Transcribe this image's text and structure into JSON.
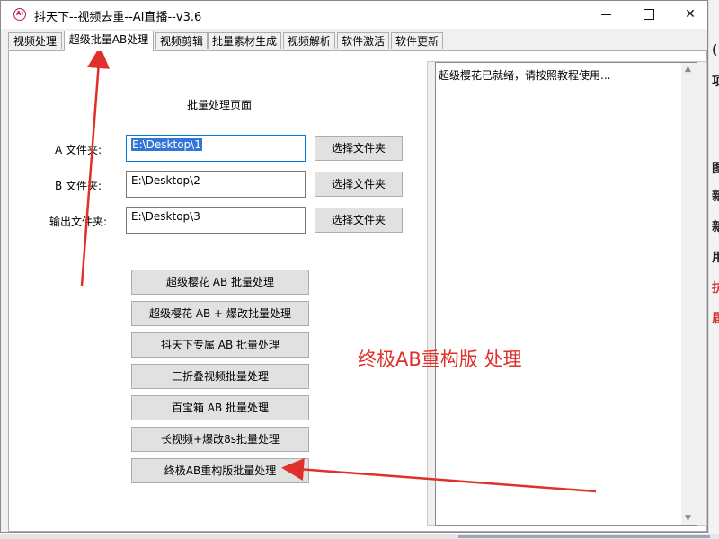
{
  "window": {
    "title": "抖天下--视频去重--AI直播--v3.6",
    "app_icon_glyph": "AI",
    "controls": {
      "minimize": "minimize-icon",
      "maximize": "maximize-icon",
      "close": "✕"
    }
  },
  "tabs": [
    {
      "label": "视频处理",
      "active": false
    },
    {
      "label": "超级批量AB处理",
      "active": true
    },
    {
      "label": "视频剪辑",
      "active": false
    },
    {
      "label": "批量素材生成",
      "active": false
    },
    {
      "label": "视频解析",
      "active": false
    },
    {
      "label": "软件激活",
      "active": false
    },
    {
      "label": "软件更新",
      "active": false
    }
  ],
  "panel": {
    "heading": "批量处理页面",
    "folders": [
      {
        "label": "A 文件夹:",
        "value": "E:\\Desktop\\1",
        "browse_label": "选择文件夹"
      },
      {
        "label": "B 文件夹:",
        "value": "E:\\Desktop\\2",
        "browse_label": "选择文件夹"
      },
      {
        "label": "输出文件夹:",
        "value": "E:\\Desktop\\3",
        "browse_label": "选择文件夹"
      }
    ],
    "process_buttons": [
      "超级樱花 AB 批量处理",
      "超级樱花 AB + 爆改批量处理",
      "抖天下专属 AB 批量处理",
      "三折叠视频批量处理",
      "百宝箱 AB 批量处理",
      "长视频+爆改8s批量处理",
      "终极AB重构版批量处理"
    ],
    "log_text": "超级樱花已就绪，请按照教程使用..."
  },
  "annotation": {
    "text": "终极AB重构版 处理",
    "color": "#e0302a"
  },
  "background_app": {
    "chars": [
      {
        "text": "(",
        "color": "#222222"
      },
      {
        "text": "项",
        "color": "#222222"
      },
      {
        "text": "图",
        "color": "#222222"
      },
      {
        "text": "新",
        "color": "#222222"
      },
      {
        "text": "新",
        "color": "#222222"
      },
      {
        "text": "用",
        "color": "#222222"
      },
      {
        "text": "抗",
        "color": "#d2352b"
      },
      {
        "text": "届",
        "color": "#d2352b"
      }
    ]
  }
}
